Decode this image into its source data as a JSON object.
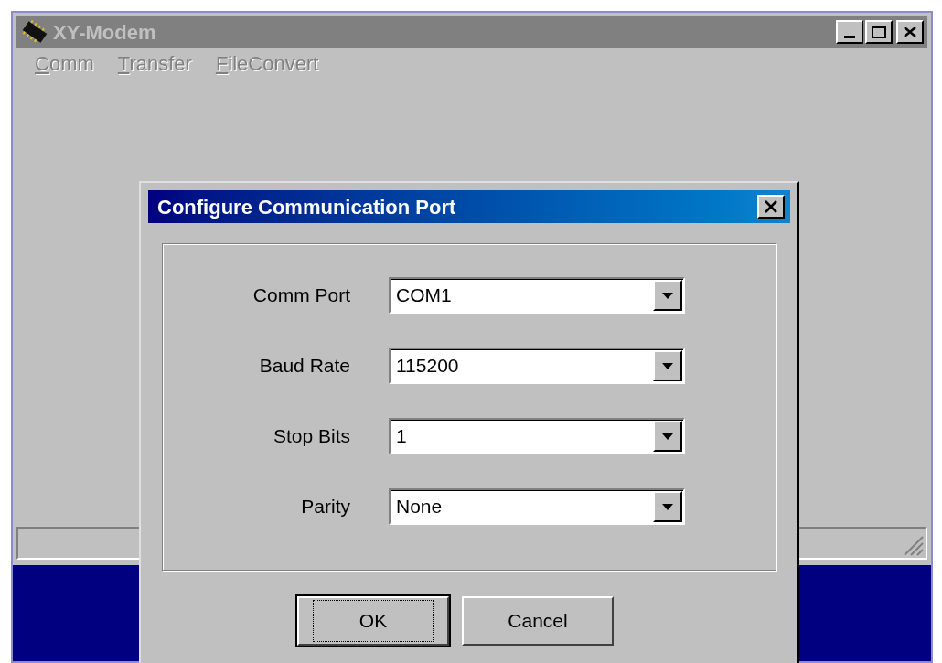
{
  "window": {
    "title": "XY-Modem",
    "active": false
  },
  "menu": [
    {
      "label": "Comm",
      "disabled": true
    },
    {
      "label": "Transfer",
      "disabled": true
    },
    {
      "label": "FileConvert",
      "disabled": true
    }
  ],
  "dialog": {
    "title": "Configure Communication Port",
    "active": true,
    "fields": [
      {
        "label": "Comm Port",
        "value": "COM1"
      },
      {
        "label": "Baud Rate",
        "value": "115200"
      },
      {
        "label": "Stop Bits",
        "value": "1"
      },
      {
        "label": "Parity",
        "value": "None"
      }
    ],
    "buttons": [
      {
        "label": "OK",
        "default": true
      },
      {
        "label": "Cancel",
        "default": false
      }
    ]
  }
}
